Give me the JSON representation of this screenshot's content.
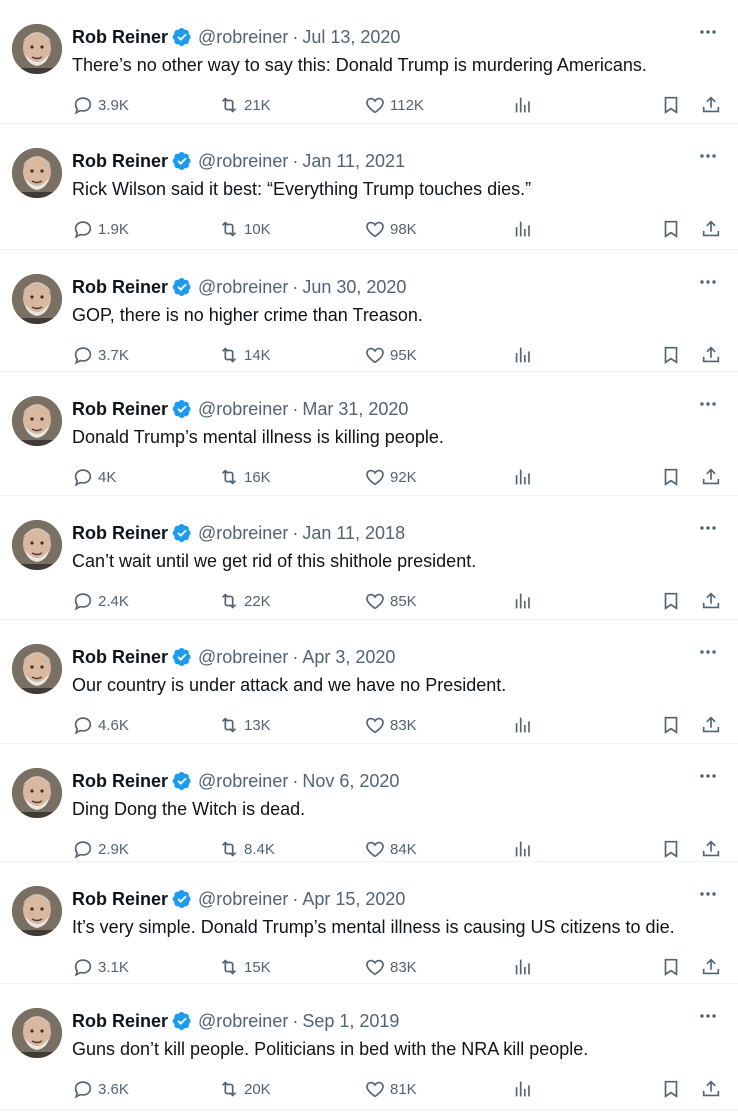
{
  "author": {
    "name": "Rob Reiner",
    "handle": "@robreiner",
    "separator": "·"
  },
  "colors": {
    "verified_badge": "#1d9bf0",
    "secondary_text": "#536471",
    "primary_text": "#0f1419",
    "divider": "#eff3f4"
  },
  "icons": [
    "verified-badge-icon",
    "more-icon",
    "reply-icon",
    "retweet-icon",
    "like-icon",
    "views-icon",
    "bookmark-icon",
    "share-icon"
  ],
  "tweets": [
    {
      "date": "Jul 13, 2020",
      "text": "There’s no other way to say this: Donald Trump is murdering Americans.",
      "replies": "3.9K",
      "retweets": "21K",
      "likes": "112K"
    },
    {
      "date": "Jan 11, 2021",
      "text": "Rick Wilson said it best: “Everything Trump touches dies.”",
      "replies": "1.9K",
      "retweets": "10K",
      "likes": "98K"
    },
    {
      "date": "Jun 30, 2020",
      "text": "GOP, there is no higher crime than Treason.",
      "replies": "3.7K",
      "retweets": "14K",
      "likes": "95K"
    },
    {
      "date": "Mar 31, 2020",
      "text": "Donald Trump’s mental illness is killing people.",
      "replies": "4K",
      "retweets": "16K",
      "likes": "92K"
    },
    {
      "date": "Jan 11, 2018",
      "text": "Can’t wait until we get rid of this shithole president.",
      "replies": "2.4K",
      "retweets": "22K",
      "likes": "85K"
    },
    {
      "date": "Apr 3, 2020",
      "text": "Our country is under attack and we have no President.",
      "replies": "4.6K",
      "retweets": "13K",
      "likes": "83K"
    },
    {
      "date": "Nov 6, 2020",
      "text": "Ding Dong the Witch is dead.",
      "replies": "2.9K",
      "retweets": "8.4K",
      "likes": "84K"
    },
    {
      "date": "Apr 15, 2020",
      "text": "It’s very simple. Donald Trump’s mental illness is causing US citizens to die.",
      "replies": "3.1K",
      "retweets": "15K",
      "likes": "83K"
    },
    {
      "date": "Sep 1, 2019",
      "text": "Guns don’t kill people. Politicians in bed with the NRA kill people.",
      "replies": "3.6K",
      "retweets": "20K",
      "likes": "81K"
    }
  ]
}
